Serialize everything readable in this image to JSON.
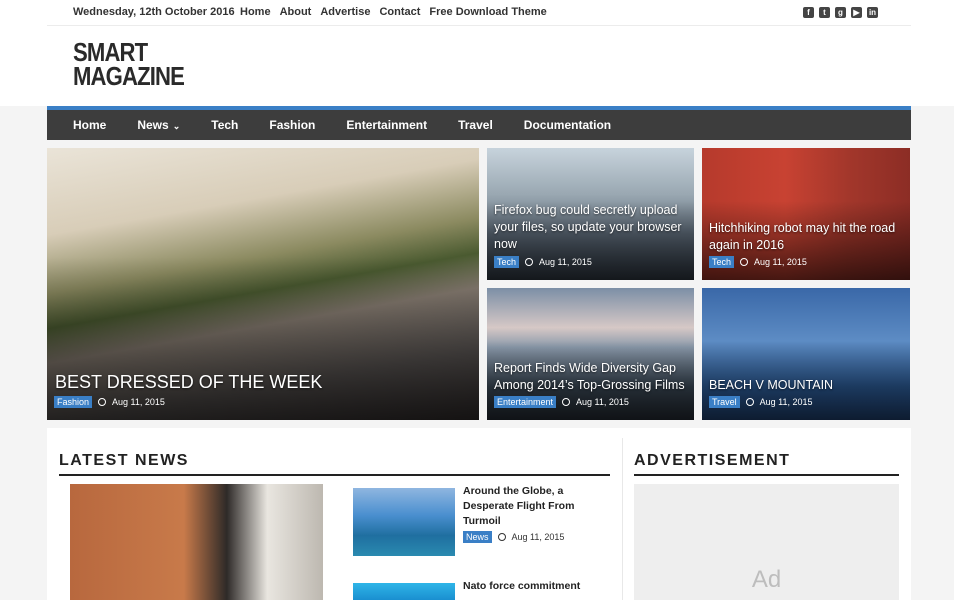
{
  "topbar": {
    "date": "Wednesday, 12th October 2016",
    "links": [
      "Home",
      "About",
      "Advertise",
      "Contact",
      "Free Download Theme"
    ],
    "social_icons": [
      "facebook-icon",
      "twitter-icon",
      "google-plus-icon",
      "youtube-icon",
      "linkedin-icon"
    ]
  },
  "logo": {
    "line1": "SMART",
    "line2": "MAGAZINE"
  },
  "nav": {
    "items": [
      "Home",
      "News",
      "Tech",
      "Fashion",
      "Entertainment",
      "Travel",
      "Documentation"
    ],
    "dropdown_caret": "⌄"
  },
  "hero": [
    {
      "title": "BEST DRESSED OF THE WEEK",
      "category": "Fashion",
      "date": "Aug 11, 2015"
    },
    {
      "title": "Firefox bug could secretly upload your files, so update your browser now",
      "category": "Tech",
      "date": "Aug 11, 2015"
    },
    {
      "title": "Hitchhiking robot may hit the road again in 2016",
      "category": "Tech",
      "date": "Aug 11, 2015"
    },
    {
      "title": "Report Finds Wide Diversity Gap Among 2014’s Top-Grossing Films",
      "category": "Entertainment",
      "date": "Aug 11, 2015"
    },
    {
      "title": "BEACH V MOUNTAIN",
      "category": "Travel",
      "date": "Aug 11, 2015"
    }
  ],
  "latest": {
    "heading": "LATEST NEWS",
    "items": [
      {
        "title": "Around the Globe, a Desperate Flight From Turmoil",
        "category": "News",
        "date": "Aug 11, 2015"
      },
      {
        "title": "Nato force commitment"
      }
    ]
  },
  "advertisement": {
    "heading": "ADVERTISEMENT",
    "placeholder": "Ad"
  },
  "colors": {
    "accent": "#3a7fc6",
    "nav_bg": "#3d3d3d"
  }
}
